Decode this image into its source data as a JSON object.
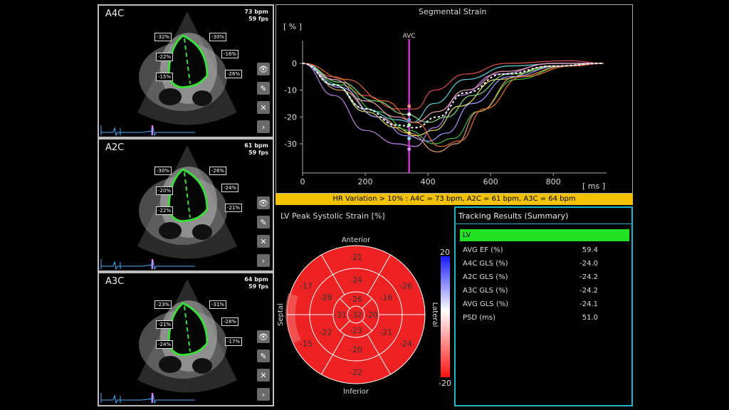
{
  "views": [
    {
      "id": "a4c",
      "name": "A4C",
      "bpm": "73 bpm",
      "fps": "59 fps",
      "labels": [
        "-32%",
        "-30%",
        "-22%",
        "-16%",
        "-15%",
        "-26%"
      ]
    },
    {
      "id": "a2c",
      "name": "A2C",
      "bpm": "61 bpm",
      "fps": "59 fps",
      "labels": [
        "-30%",
        "-26%",
        "-20%",
        "-24%",
        "-22%",
        "-21%"
      ]
    },
    {
      "id": "a3c",
      "name": "A3C",
      "bpm": "64 bpm",
      "fps": "59 fps",
      "labels": [
        "-23%",
        "-31%",
        "-21%",
        "-28%",
        "-24%",
        "-17%"
      ]
    }
  ],
  "tools": {
    "eye": "eye-icon",
    "edit": "pencil-icon",
    "close": "close-icon",
    "next": "chevron-right-icon"
  },
  "strain": {
    "title": "Segmental Strain",
    "y_unit": "[ % ]",
    "x_unit": "[ ms ]",
    "avc_label": "AVC",
    "chart_data": {
      "type": "line",
      "xlim": [
        0,
        970
      ],
      "ylim": [
        -37,
        5
      ],
      "x_ticks": [
        0,
        200,
        400,
        600,
        800
      ],
      "y_ticks": [
        0,
        -10,
        -20,
        -30
      ],
      "avc_x": 340,
      "series": [
        {
          "color": "#e05050",
          "points": [
            [
              0,
              0
            ],
            [
              100,
              -5
            ],
            [
              200,
              -12
            ],
            [
              300,
              -17
            ],
            [
              360,
              -17
            ],
            [
              420,
              -10
            ],
            [
              520,
              -4
            ],
            [
              650,
              0
            ],
            [
              850,
              1
            ],
            [
              960,
              0
            ]
          ]
        },
        {
          "color": "#e8e060",
          "points": [
            [
              0,
              0
            ],
            [
              100,
              -8
            ],
            [
              200,
              -18
            ],
            [
              300,
              -24
            ],
            [
              360,
              -27
            ],
            [
              420,
              -25
            ],
            [
              500,
              -16
            ],
            [
              620,
              -6
            ],
            [
              800,
              -1
            ],
            [
              960,
              0
            ]
          ]
        },
        {
          "color": "#40c040",
          "points": [
            [
              0,
              0
            ],
            [
              120,
              -8
            ],
            [
              240,
              -18
            ],
            [
              340,
              -25
            ],
            [
              420,
              -30
            ],
            [
              480,
              -28
            ],
            [
              560,
              -18
            ],
            [
              680,
              -6
            ],
            [
              840,
              -1
            ],
            [
              960,
              0
            ]
          ]
        },
        {
          "color": "#e8a060",
          "points": [
            [
              0,
              0
            ],
            [
              120,
              -10
            ],
            [
              240,
              -20
            ],
            [
              340,
              -26
            ],
            [
              430,
              -33
            ],
            [
              490,
              -30
            ],
            [
              560,
              -18
            ],
            [
              680,
              -5
            ],
            [
              840,
              -1
            ],
            [
              960,
              0
            ]
          ]
        },
        {
          "color": "#c080e0",
          "points": [
            [
              0,
              0
            ],
            [
              100,
              -12
            ],
            [
              200,
              -25
            ],
            [
              300,
              -30
            ],
            [
              360,
              -31
            ],
            [
              420,
              -24
            ],
            [
              500,
              -12
            ],
            [
              620,
              -4
            ],
            [
              800,
              0
            ],
            [
              960,
              0
            ]
          ]
        },
        {
          "color": "#60d0e0",
          "points": [
            [
              0,
              0
            ],
            [
              100,
              -8
            ],
            [
              200,
              -17
            ],
            [
              300,
              -21
            ],
            [
              350,
              -22
            ],
            [
              420,
              -15
            ],
            [
              520,
              -6
            ],
            [
              660,
              -1
            ],
            [
              820,
              0
            ],
            [
              960,
              0
            ]
          ]
        },
        {
          "color": "#80e080",
          "points": [
            [
              0,
              0
            ],
            [
              120,
              -7
            ],
            [
              230,
              -14
            ],
            [
              330,
              -19
            ],
            [
              400,
              -22
            ],
            [
              460,
              -20
            ],
            [
              540,
              -12
            ],
            [
              660,
              -4
            ],
            [
              820,
              -1
            ],
            [
              960,
              0
            ]
          ]
        },
        {
          "color": "#f0a0c0",
          "points": [
            [
              0,
              0
            ],
            [
              100,
              -6
            ],
            [
              200,
              -14
            ],
            [
              300,
              -20
            ],
            [
              360,
              -22
            ],
            [
              430,
              -18
            ],
            [
              520,
              -10
            ],
            [
              640,
              -3
            ],
            [
              800,
              0
            ],
            [
              960,
              0
            ]
          ]
        },
        {
          "color": "#a0a0ff",
          "points": [
            [
              0,
              0
            ],
            [
              120,
              -9
            ],
            [
              240,
              -20
            ],
            [
              330,
              -27
            ],
            [
              400,
              -29
            ],
            [
              460,
              -26
            ],
            [
              540,
              -15
            ],
            [
              660,
              -5
            ],
            [
              820,
              -1
            ],
            [
              960,
              0
            ]
          ]
        },
        {
          "color": "#e07030",
          "points": [
            [
              0,
              0
            ],
            [
              140,
              -6
            ],
            [
              260,
              -14
            ],
            [
              360,
              -22
            ],
            [
              440,
              -31
            ],
            [
              500,
              -29
            ],
            [
              580,
              -17
            ],
            [
              700,
              -5
            ],
            [
              860,
              -1
            ],
            [
              960,
              0
            ]
          ]
        },
        {
          "color": "#ffffff",
          "dashed": true,
          "points": [
            [
              0,
              0
            ],
            [
              100,
              -8
            ],
            [
              200,
              -17
            ],
            [
              300,
              -23
            ],
            [
              360,
              -24
            ],
            [
              430,
              -20
            ],
            [
              520,
              -11
            ],
            [
              640,
              -4
            ],
            [
              800,
              -1
            ],
            [
              960,
              0
            ]
          ]
        }
      ]
    }
  },
  "banner": "HR Variation > 10% : A4C = 73 bpm, A2C = 61 bpm, A3C = 64 bpm",
  "bullseye": {
    "title": "LV Peak Systolic Strain [%]",
    "anterior": "Anterior",
    "inferior": "Inferior",
    "septal": "Septal",
    "lateral": "Lateral",
    "scale_max": "20",
    "scale_min": "-20",
    "basal": [
      "-21",
      "-26",
      "-24",
      "-22",
      "-15",
      "-17"
    ],
    "mid": [
      "-24",
      "-16",
      "-21",
      "-20",
      "-22",
      "-28"
    ],
    "apical": [
      "-26",
      "-20",
      "-23",
      "-31"
    ],
    "apex": "-32"
  },
  "summary": {
    "title": "Tracking Results (Summary)",
    "lv": "LV",
    "rows": [
      {
        "k": "AVG EF (%)",
        "v": "59.4"
      },
      {
        "k": "A4C GLS (%)",
        "v": "-24.0"
      },
      {
        "k": "A2C GLS (%)",
        "v": "-24.2"
      },
      {
        "k": "A3C GLS (%)",
        "v": "-24.2"
      },
      {
        "k": "AVG GLS (%)",
        "v": "-24.1"
      },
      {
        "k": "PSD (ms)",
        "v": "51.0"
      }
    ]
  },
  "colors": {
    "accent": "#1fb3c7",
    "banner": "#f2c200",
    "lv": "#22e022",
    "avc": "#cc33cc",
    "bullseye": "#ee2222"
  }
}
